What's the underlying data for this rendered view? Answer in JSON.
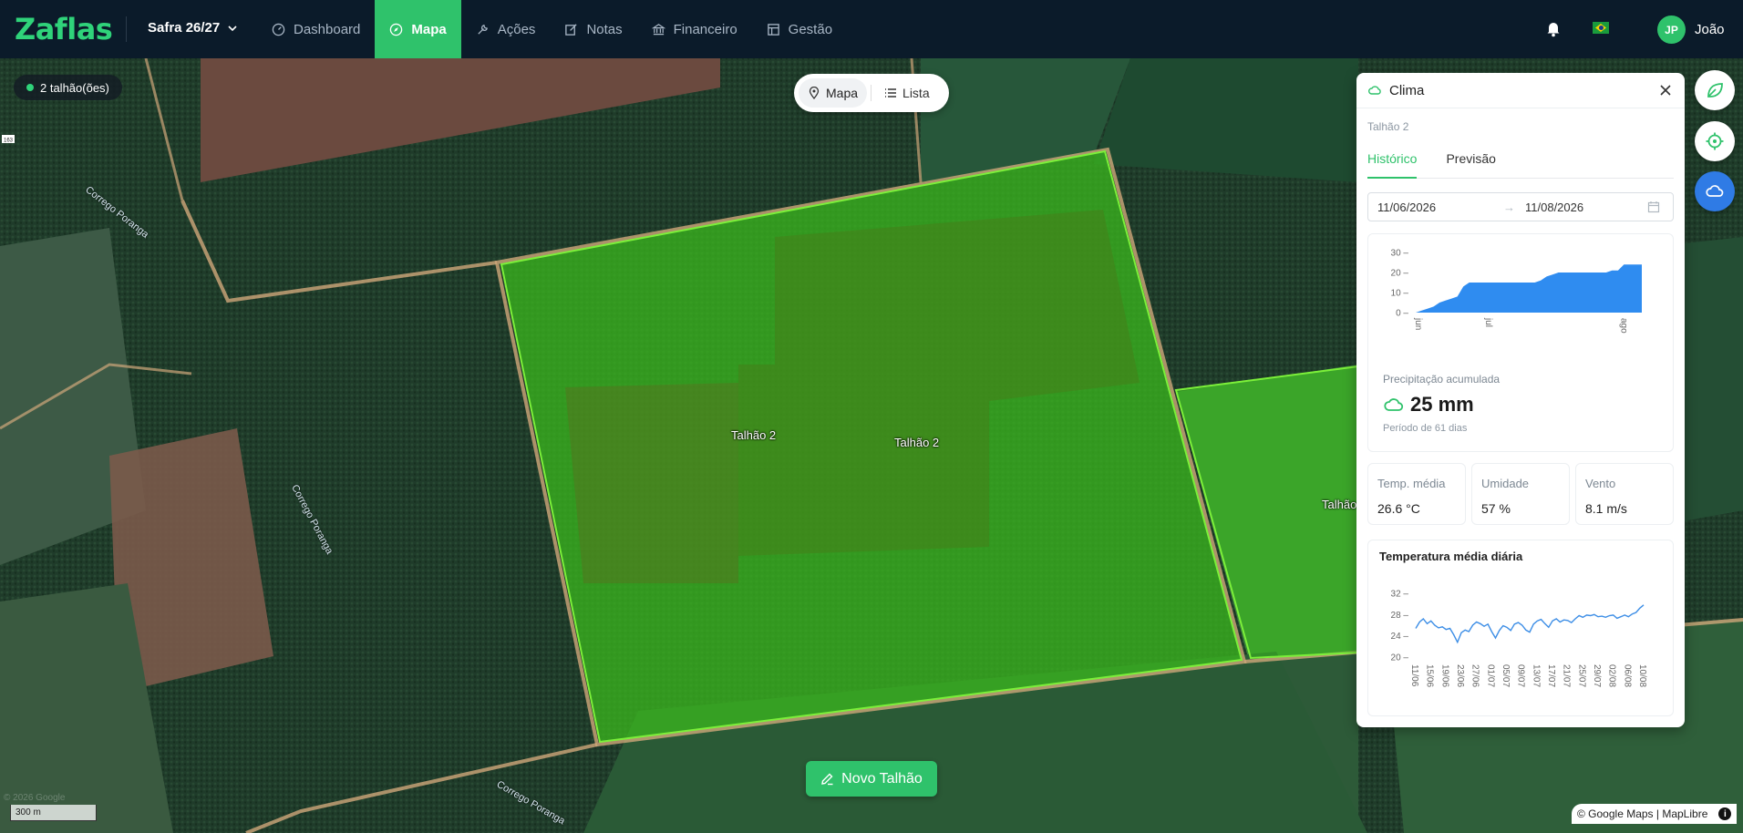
{
  "app": {
    "logo": "Zaflas",
    "safra": "Safra 26/27"
  },
  "nav": [
    {
      "label": "Dashboard",
      "icon": "gauge-icon",
      "active": false
    },
    {
      "label": "Mapa",
      "icon": "compass-icon",
      "active": true
    },
    {
      "label": "Ações",
      "icon": "wrench-icon",
      "active": false
    },
    {
      "label": "Notas",
      "icon": "edit-icon",
      "active": false
    },
    {
      "label": "Financeiro",
      "icon": "bank-icon",
      "active": false
    },
    {
      "label": "Gestão",
      "icon": "table-icon",
      "active": false
    }
  ],
  "user": {
    "initials": "JP",
    "name": "João"
  },
  "map": {
    "field_count": "2 talhão(ões)",
    "toggle": {
      "map_label": "Mapa",
      "list_label": "Lista"
    },
    "field_labels": [
      "Talhão 2",
      "Talhão 2",
      "Talhão"
    ],
    "river_labels": [
      "Corrego Poranga",
      "Corrego Poranga",
      "Corrego Poranga"
    ],
    "new_field_button": "Novo Talhão",
    "scale": "300 m",
    "attribution": "© Google Maps | MapLibre",
    "watermark": "© 2026 Google",
    "road_shield": "163"
  },
  "climate": {
    "title": "Clima",
    "field": "Talhão 2",
    "tabs": [
      "Histórico",
      "Previsão"
    ],
    "date_start": "11/06/2026",
    "date_end": "11/08/2026",
    "precip_label": "Precipitação acumulada",
    "precip_value": "25 mm",
    "precip_period": "Período de 61 dias",
    "stats": [
      {
        "label": "Temp. média",
        "value": "26.6 °C"
      },
      {
        "label": "Umidade",
        "value": "57 %"
      },
      {
        "label": "Vento",
        "value": "8.1 m/s"
      }
    ],
    "temp_chart_title": "Temperatura média diária"
  },
  "colors": {
    "brand_green": "#2fc26b",
    "topbar": "#0b1b2a",
    "precip_blue": "#2f8cf0",
    "temp_line": "#3d8ee6"
  },
  "chart_data": [
    {
      "type": "area",
      "title": "",
      "x_ticks": [
        "jun",
        "jul",
        "ago"
      ],
      "y_ticks": [
        0,
        10,
        20,
        30
      ],
      "ylim": [
        0,
        30
      ],
      "series": [
        {
          "values": [
            0,
            1,
            2,
            3,
            5,
            6,
            7,
            8,
            13,
            15,
            15,
            15,
            15,
            15,
            15,
            15,
            15,
            15,
            15,
            15,
            15,
            16,
            18,
            19,
            20,
            20,
            20,
            20,
            20,
            20,
            20,
            20,
            20,
            21,
            21,
            24,
            24,
            24,
            24
          ]
        }
      ]
    },
    {
      "type": "line",
      "title": "Temperatura média diária",
      "x": [
        "11/06",
        "15/06",
        "19/06",
        "23/06",
        "27/06",
        "01/07",
        "05/07",
        "09/07",
        "13/07",
        "17/07",
        "21/07",
        "25/07",
        "29/07",
        "02/08",
        "06/08",
        "10/08"
      ],
      "y_ticks": [
        20,
        24,
        28,
        32
      ],
      "ylim": [
        20,
        32
      ],
      "series": [
        {
          "values": [
            25.4,
            26.6,
            27.2,
            26.3,
            26.8,
            26.0,
            25.5,
            25.7,
            25.2,
            25.4,
            24.2,
            22.8,
            24.6,
            25.1,
            24.8,
            26.0,
            26.6,
            26.3,
            25.8,
            26.2,
            24.8,
            23.6,
            25.0,
            25.9,
            25.6,
            25.0,
            26.2,
            26.5,
            26.0,
            25.1,
            24.7,
            26.2,
            26.8,
            27.1,
            26.3,
            25.6,
            26.8,
            27.2,
            26.6,
            27.0,
            26.9,
            26.5,
            27.2,
            27.8,
            27.5,
            27.9,
            27.8,
            28.0,
            27.6,
            27.7,
            27.5,
            27.8,
            27.9,
            27.3,
            27.6,
            27.9,
            27.6,
            28.1,
            28.4,
            29.2,
            29.8
          ]
        }
      ]
    }
  ]
}
